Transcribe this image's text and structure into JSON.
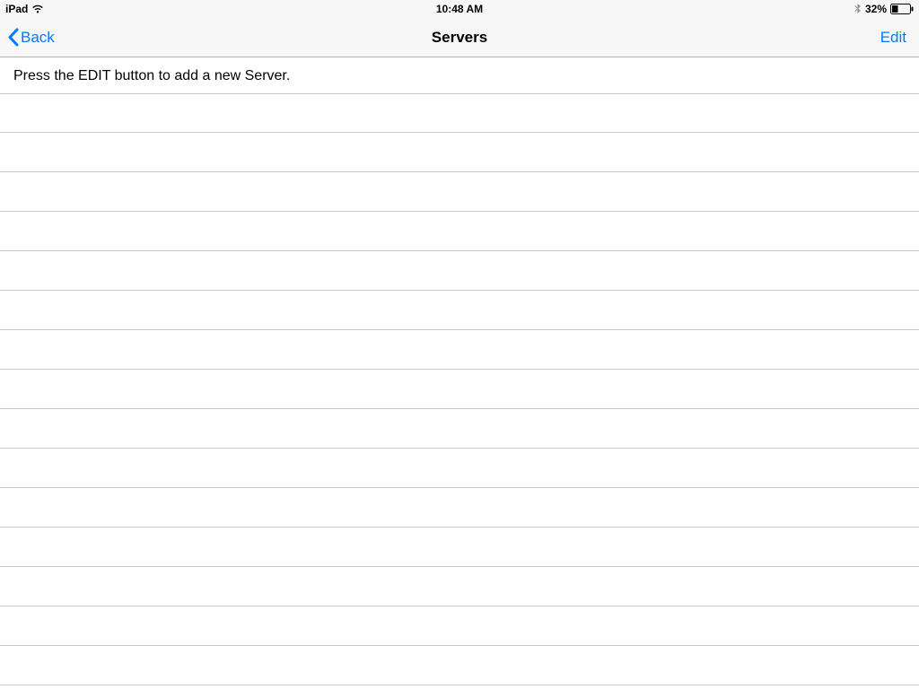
{
  "status": {
    "device": "iPad",
    "time": "10:48 AM",
    "battery_pct": "32%"
  },
  "nav": {
    "back_label": "Back",
    "title": "Servers",
    "edit_label": "Edit"
  },
  "instruction": "Press the EDIT button to add a new Server.",
  "rows": [
    "",
    "",
    "",
    "",
    "",
    "",
    "",
    "",
    "",
    "",
    "",
    "",
    "",
    "",
    ""
  ]
}
